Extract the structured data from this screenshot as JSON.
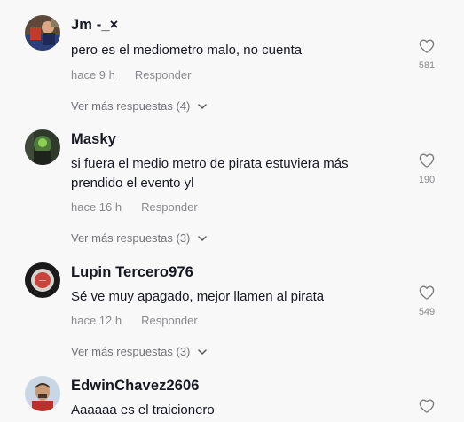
{
  "comments": [
    {
      "username": "Jm -_×",
      "text": "pero es el mediometro malo, no cuenta",
      "time": "hace 9 h",
      "reply": "Responder",
      "likes": "581",
      "more_replies": "Ver más respuestas (4)"
    },
    {
      "username": "Masky",
      "text": "si fuera el medio metro de pirata estuviera más prendido el evento yl",
      "time": "hace 16 h",
      "reply": "Responder",
      "likes": "190",
      "more_replies": "Ver más respuestas (3)"
    },
    {
      "username": "Lupin Tercero976",
      "text": "Sé ve muy apagado, mejor llamen al pirata",
      "time": "hace 12 h",
      "reply": "Responder",
      "likes": "549",
      "more_replies": "Ver más respuestas (3)"
    },
    {
      "username": "EdwinChavez2606",
      "text": "Aaaaaa es el traicionero",
      "time": "",
      "reply": "",
      "likes": "",
      "more_replies": ""
    }
  ],
  "icons": {
    "like": "heart-outline-icon",
    "expand": "chevron-down-icon"
  },
  "colors": {
    "background": "#f8f8f8",
    "text_primary": "#161823",
    "text_secondary": "#8a8b91"
  }
}
